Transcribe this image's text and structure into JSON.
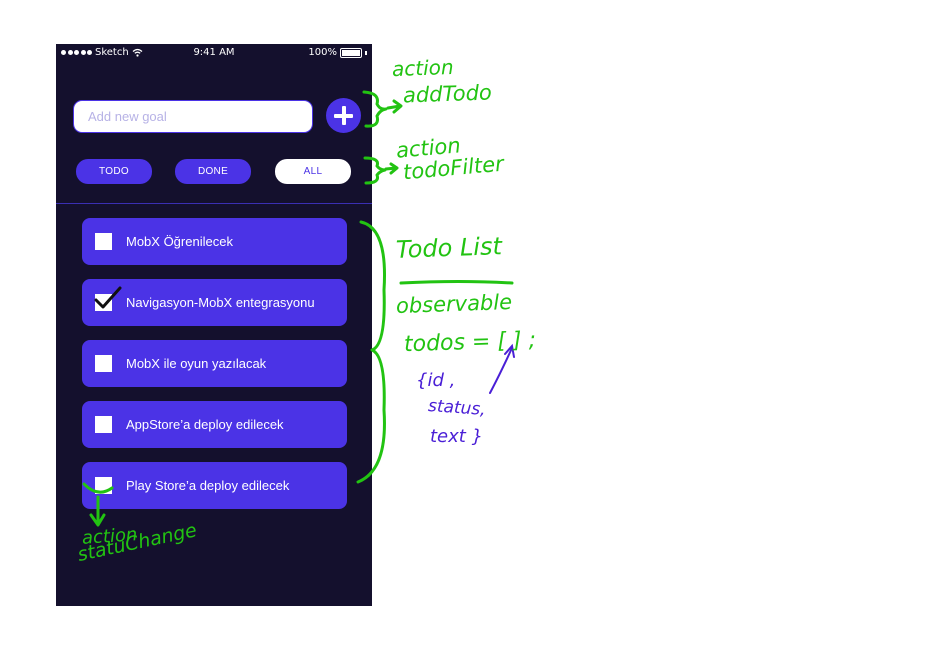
{
  "status_bar": {
    "carrier": "Sketch",
    "time": "9:41 AM",
    "battery": "100%"
  },
  "input": {
    "placeholder": "Add new goal",
    "value": ""
  },
  "add_button": {
    "icon": "plus-icon"
  },
  "filters": {
    "todo_label": "TODO",
    "done_label": "DONE",
    "all_label": "ALL",
    "selected": "ALL"
  },
  "todos": [
    {
      "text": "MobX Öğrenilecek",
      "checked": false
    },
    {
      "text": "Navigasyon-MobX entegrasyonu",
      "checked": true
    },
    {
      "text": "MobX ile oyun yazılacak",
      "checked": false
    },
    {
      "text": "AppStore’a deploy edilecek",
      "checked": false
    },
    {
      "text": "Play Store’a deploy edilecek",
      "checked": false
    }
  ],
  "annotations": {
    "add_todo_line1": "action",
    "add_todo_line2": "addTodo",
    "filter_line1": "action",
    "filter_line2": "todoFilter",
    "todo_list_title": "Todo List",
    "observable": "observable",
    "todos_expr": "todos = [ ] ;",
    "fields_line1": "{id ,",
    "fields_line2": "status,",
    "fields_line3": "text }",
    "status_line1": "action",
    "status_line2": "statuChange"
  },
  "colors": {
    "background": "#14102d",
    "accent": "#4b33e6",
    "annotation_green": "#22c312",
    "annotation_purple": "#4a1fd6"
  }
}
